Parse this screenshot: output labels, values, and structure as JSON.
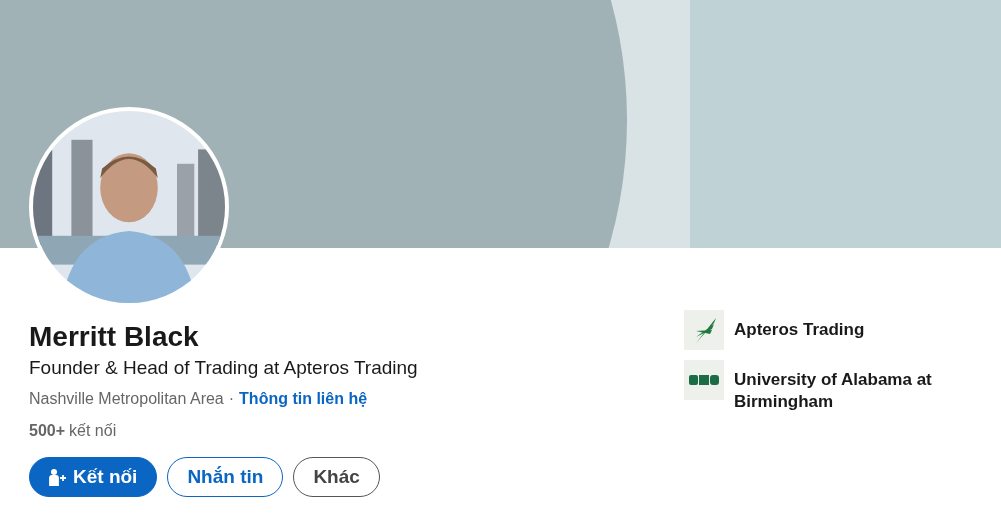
{
  "profile": {
    "name": "Merritt Black",
    "headline": "Founder & Head of Trading at Apteros Trading",
    "location": "Nashville Metropolitan Area",
    "separator": "·",
    "contact_link": "Thông tin liên hệ",
    "connections_count": "500+",
    "connections_label": "kết nối"
  },
  "actions": [
    {
      "kind": "primary",
      "label": "Kết nối"
    },
    {
      "kind": "secondary",
      "label": "Nhắn tin"
    },
    {
      "kind": "tertiary",
      "label": "Khác"
    }
  ],
  "affiliations": [
    {
      "kind": "company",
      "name": "Apteros Trading"
    },
    {
      "kind": "school",
      "name": "University of Alabama at Birmingham"
    }
  ]
}
